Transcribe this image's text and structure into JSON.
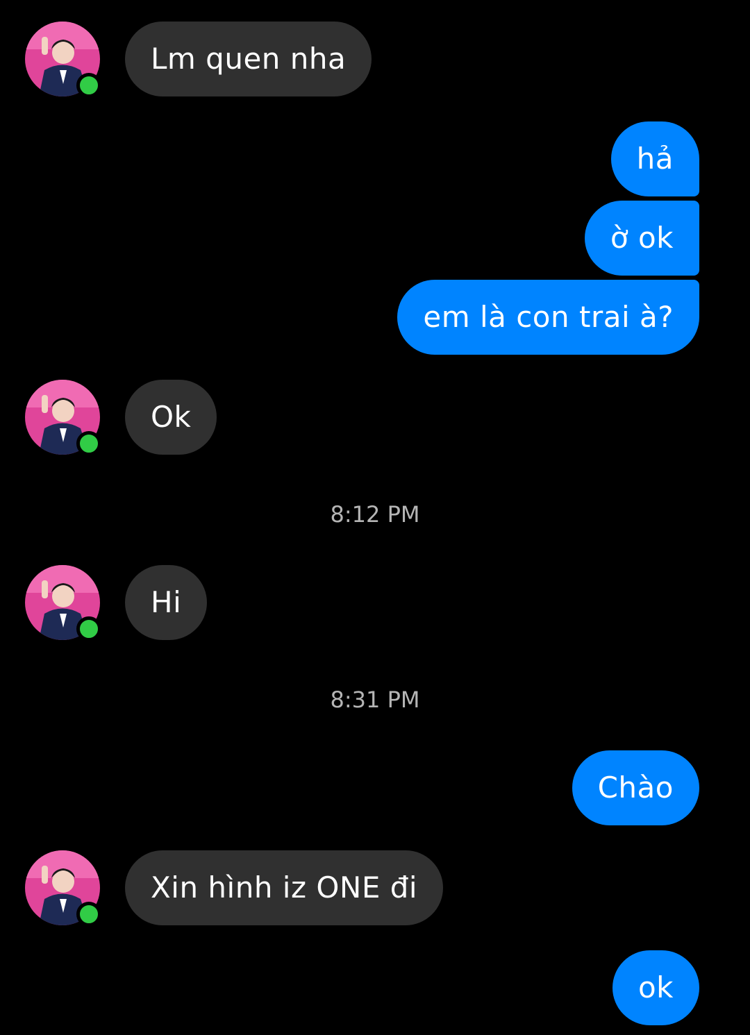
{
  "colors": {
    "background": "#000000",
    "incoming_bubble": "#303030",
    "outgoing_bubble": "#0084ff",
    "online": "#31cc46",
    "timestamp_text": "#b5b5b5"
  },
  "messages": {
    "m1": "Lm quen nha",
    "m2": "hả",
    "m3": "ờ ok",
    "m4": "em là con trai à?",
    "m5": "Ok",
    "m6": "Hi",
    "m7": "Chào",
    "m8": "Xin hình iz ONE đi",
    "m9": "ok"
  },
  "timestamps": {
    "t1": "8:12 PM",
    "t2": "8:31 PM"
  },
  "contact": {
    "avatar_icon": "contact-avatar-photo",
    "status": "online"
  }
}
